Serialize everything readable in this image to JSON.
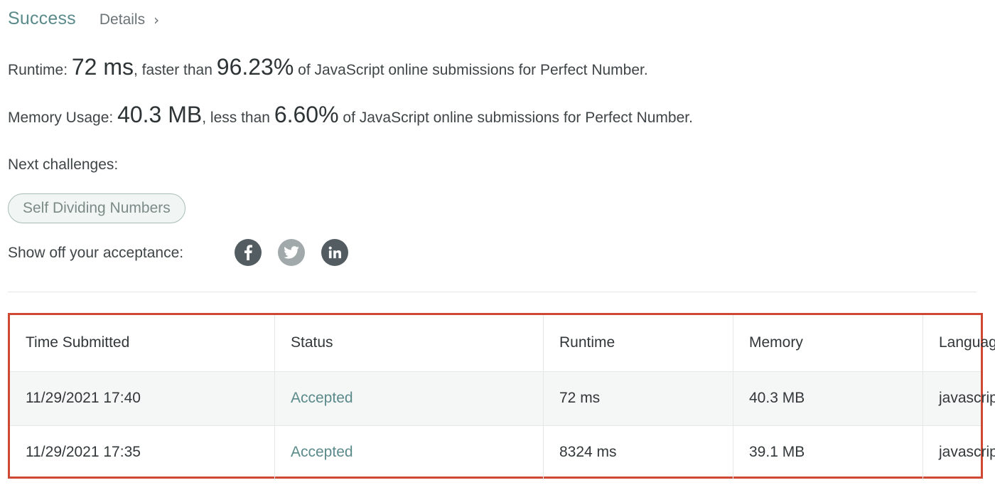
{
  "header": {
    "status": "Success",
    "details_label": "Details",
    "details_chevron": "›"
  },
  "runtime": {
    "label": "Runtime:",
    "value": "72 ms",
    "comparison_text": ", faster than",
    "percent": "96.23%",
    "suffix": "of JavaScript online submissions for Perfect Number."
  },
  "memory": {
    "label": "Memory Usage:",
    "value": "40.3 MB",
    "comparison_text": ", less than",
    "percent": "6.60%",
    "suffix": "of JavaScript online submissions for Perfect Number."
  },
  "next_challenges": {
    "label": "Next challenges:",
    "items": [
      "Self Dividing Numbers"
    ]
  },
  "share": {
    "label": "Show off your acceptance:",
    "icons": [
      "facebook-icon",
      "twitter-icon",
      "linkedin-icon"
    ]
  },
  "submissions": {
    "columns": [
      "Time Submitted",
      "Status",
      "Runtime",
      "Memory",
      "Language"
    ],
    "rows": [
      {
        "time": "11/29/2021 17:40",
        "status": "Accepted",
        "runtime": "72 ms",
        "memory": "40.3 MB",
        "language": "javascript"
      },
      {
        "time": "11/29/2021 17:35",
        "status": "Accepted",
        "runtime": "8324 ms",
        "memory": "39.1 MB",
        "language": "javascript"
      }
    ]
  },
  "colors": {
    "accent": "#5b8a8a",
    "highlight_border": "#cf4834",
    "social_dark": "#535d61",
    "social_light": "#a1a9ab"
  }
}
